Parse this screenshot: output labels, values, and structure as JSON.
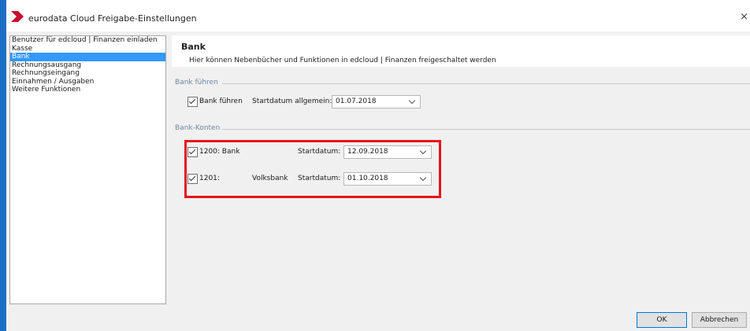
{
  "window": {
    "title": "eurodata Cloud Freigabe-Einstellungen",
    "close_symbol": "×"
  },
  "sidebar": {
    "items": [
      {
        "label": "Benutzer für edcloud | Finanzen einladen",
        "selected": false
      },
      {
        "label": "Kasse",
        "selected": false
      },
      {
        "label": "Bank",
        "selected": true
      },
      {
        "label": "Rechnungsausgang",
        "selected": false
      },
      {
        "label": "Rechnungseingang",
        "selected": false
      },
      {
        "label": "Einnahmen / Ausgaben",
        "selected": false
      },
      {
        "label": "Weitere Funktionen",
        "selected": false
      }
    ]
  },
  "page": {
    "title": "Bank",
    "description": "Hier können Nebenbücher und Funktionen in edcloud | Finanzen freigeschaltet werden"
  },
  "bank_fuehren": {
    "section_label": "Bank führen",
    "checkbox_label": "Bank führen",
    "checked": true,
    "startdate_label": "Startdatum allgemein:",
    "startdate_value": "01.07.2018"
  },
  "bank_konten": {
    "section_label": "Bank-Konten",
    "accounts": [
      {
        "label": "1200: Bank",
        "name": "",
        "checked": true,
        "startdate_label": "Startdatum:",
        "startdate_value": "12.09.2018"
      },
      {
        "label": "1201:",
        "name": "Volksbank",
        "checked": true,
        "startdate_label": "Startdatum:",
        "startdate_value": "01.10.2018"
      }
    ]
  },
  "buttons": {
    "ok": "OK",
    "cancel": "Abbrechen"
  },
  "colors": {
    "accent": "#3399ff",
    "highlight": "#e8141b",
    "brand": "#c8102e",
    "section_label": "#6f86a0"
  }
}
